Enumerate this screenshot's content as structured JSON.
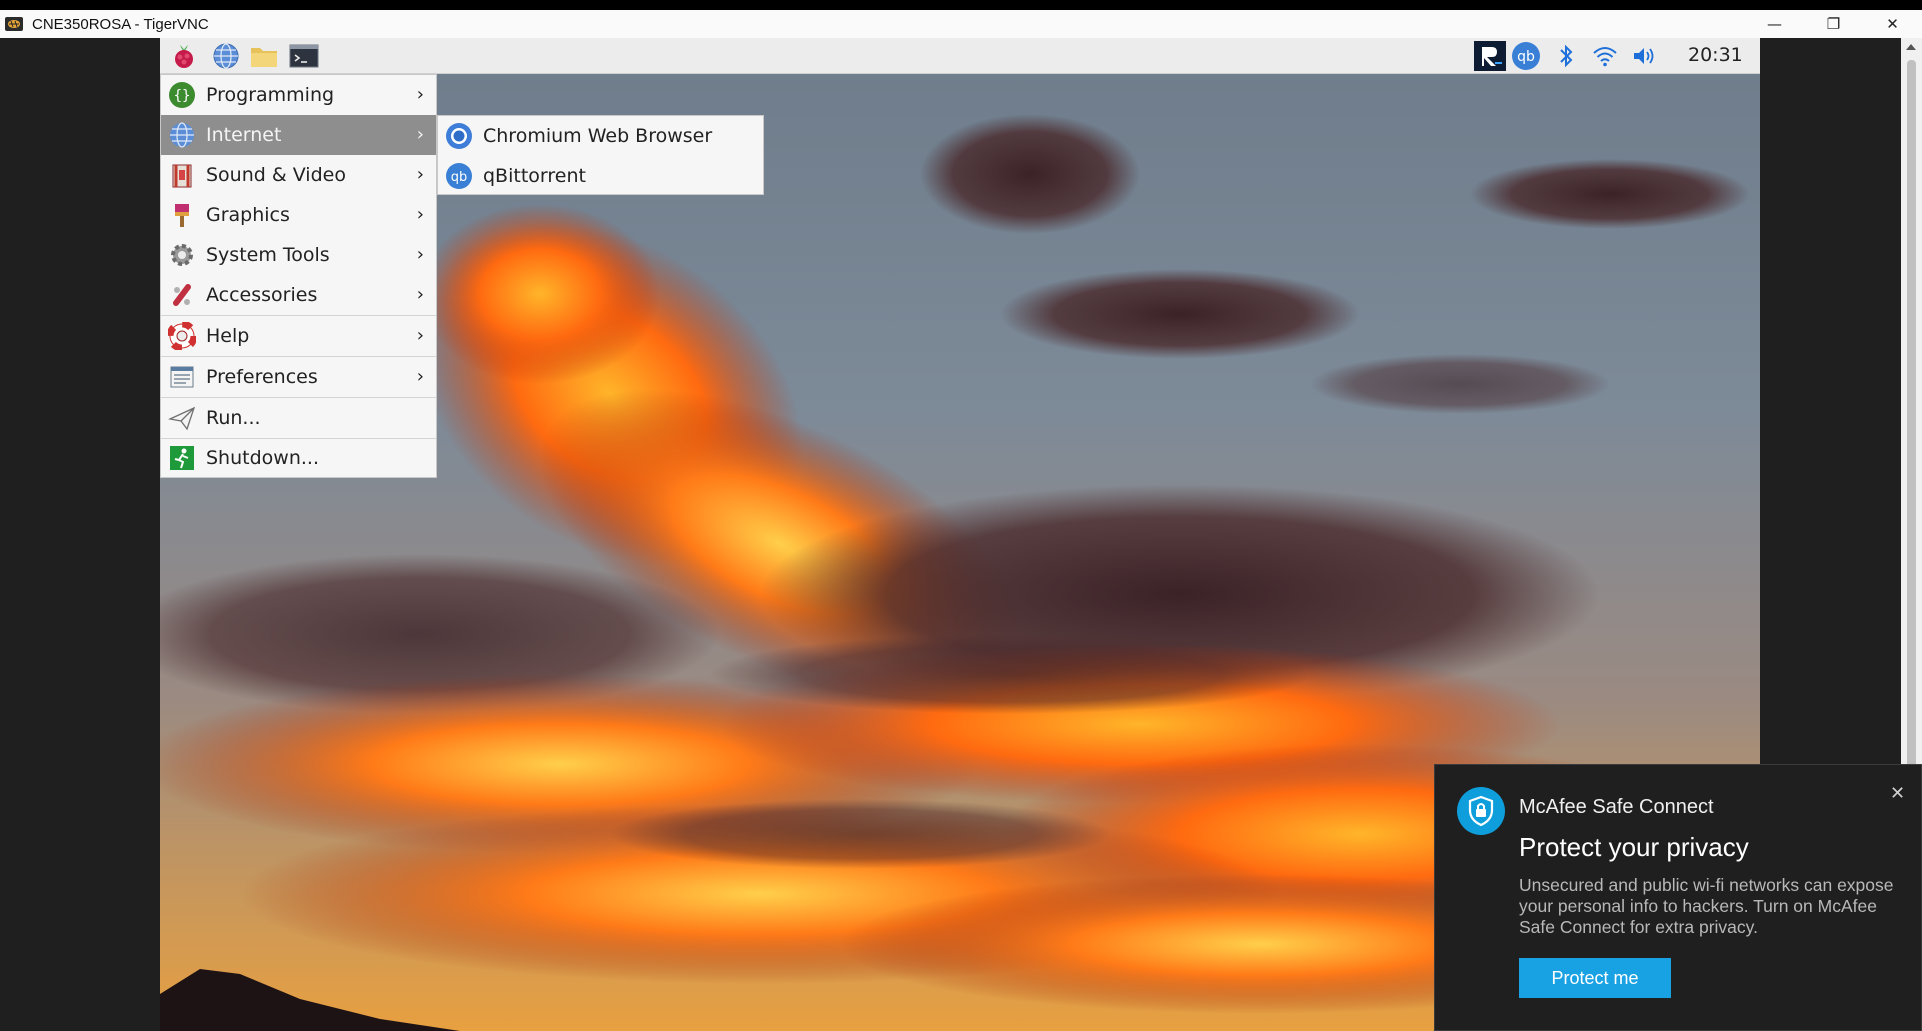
{
  "window": {
    "title": "CNE350ROSA - TigerVNC",
    "controls": {
      "minimize": "—",
      "restore": "❐",
      "close": "✕"
    }
  },
  "taskbar": {
    "launchers": [
      {
        "name": "raspberry-menu-icon"
      },
      {
        "name": "globe-icon"
      },
      {
        "name": "folder-icon"
      },
      {
        "name": "terminal-icon"
      }
    ],
    "tray": {
      "qbittorrent_label": "qb",
      "clock": "20:31"
    }
  },
  "main_menu": {
    "items": [
      {
        "label": "Programming",
        "icon": "programming-icon",
        "has_submenu": true
      },
      {
        "label": "Internet",
        "icon": "globe-icon",
        "has_submenu": true,
        "active": true
      },
      {
        "label": "Sound & Video",
        "icon": "sound-video-icon",
        "has_submenu": true
      },
      {
        "label": "Graphics",
        "icon": "graphics-icon",
        "has_submenu": true
      },
      {
        "label": "System Tools",
        "icon": "gear-icon",
        "has_submenu": true
      },
      {
        "label": "Accessories",
        "icon": "accessories-icon",
        "has_submenu": true
      },
      {
        "label": "Help",
        "icon": "lifebuoy-icon",
        "has_submenu": true
      },
      {
        "label": "Preferences",
        "icon": "preferences-icon",
        "has_submenu": true
      },
      {
        "label": "Run...",
        "icon": "paper-plane-icon",
        "has_submenu": false
      },
      {
        "label": "Shutdown...",
        "icon": "exit-icon",
        "has_submenu": false
      }
    ],
    "arrow": "›"
  },
  "internet_submenu": {
    "items": [
      {
        "label": "Chromium Web Browser",
        "icon": "chromium-icon"
      },
      {
        "label": "qBittorrent",
        "icon": "qbittorrent-icon",
        "icon_text": "qb"
      }
    ]
  },
  "toast": {
    "app": "McAfee Safe Connect",
    "title": "Protect your privacy",
    "body": "Unsecured and public wi-fi networks can expose your personal info to hackers. Turn on McAfee Safe Connect for extra privacy.",
    "button": "Protect me",
    "close": "✕"
  },
  "colors": {
    "menu_active": "#8e8e8e",
    "toast_bg": "#1f1f1f",
    "toast_button": "#19a2e3"
  }
}
